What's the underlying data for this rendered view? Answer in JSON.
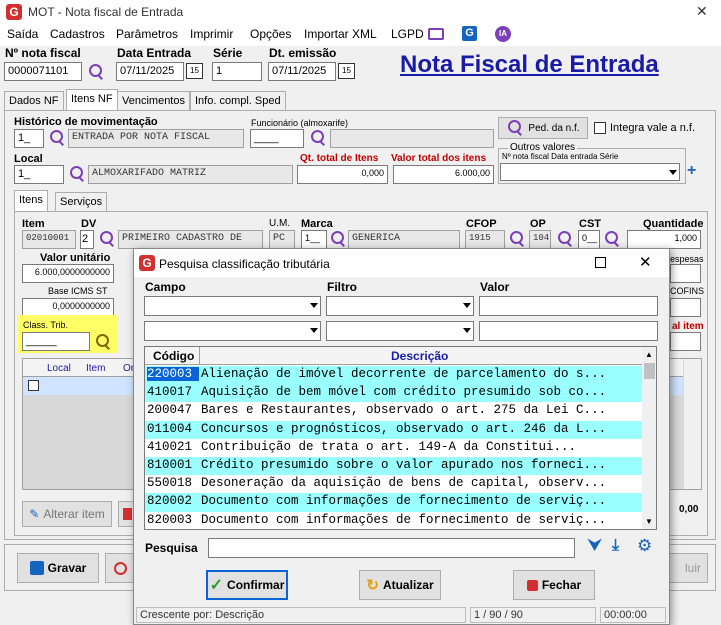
{
  "window": {
    "title": "MOT - Nota fiscal de Entrada",
    "close": "✕"
  },
  "menu": [
    "Saída",
    "Cadastros",
    "Parâmetros",
    "Imprimir",
    "Opções",
    "Importar XML",
    "LGPD"
  ],
  "menu_icons": [
    "monitor-icon",
    "g-brand-icon",
    "ia-icon"
  ],
  "ia_label": "IA",
  "header": {
    "nota_label": "Nº nota fiscal",
    "nota_value": "0000071101",
    "data_entrada_label": "Data Entrada",
    "data_entrada_value": "07/11/2025",
    "serie_label": "Série",
    "serie_value": "1",
    "dt_emissao_label": "Dt. emissão",
    "dt_emissao_value": "07/11/2025",
    "cal": "15",
    "big_title": "Nota Fiscal de Entrada"
  },
  "tabs": [
    "Dados NF",
    "Itens NF",
    "Vencimentos",
    "Info. compl. Sped"
  ],
  "itensnf": {
    "historico_label": "Histórico de movimentação",
    "historico_code": "1_",
    "historico_desc": "ENTRADA POR NOTA FISCAL",
    "funcionario_label": "Funcionário (almoxarife)",
    "funcionario_value": "____",
    "ped_button": "Ped. da n.f.",
    "integra_label": "Integra vale a n.f.",
    "local_label": "Local",
    "local_code": "1_",
    "local_desc": "ALMOXARIFADO MATRIZ",
    "qt_total_label": "Qt. total de Itens",
    "qt_total_value": "0,000",
    "valor_total_label": "Valor total dos itens",
    "valor_total_value": "6.000,00",
    "outros_label": "Outros valores",
    "outros_cols": "Nº nota fiscal   Data entrada   Série",
    "plus": "+"
  },
  "subtabs": [
    "Itens",
    "Serviços"
  ],
  "item": {
    "item_label": "Item",
    "item_value": "02010001",
    "dv_label": "DV",
    "dv_value": "2",
    "desc_value": "PRIMEIRO CADASTRO DE",
    "um_label": "U.M.",
    "um_value": "PC",
    "marca_label": "Marca",
    "marca_code": "1__",
    "marca_desc": "GENERICA",
    "cfop_label": "CFOP",
    "cfop_value": "1915",
    "op_label": "OP",
    "op_value": "104",
    "cst_label": "CST",
    "cst_value": "0__",
    "qtd_label": "Quantidade",
    "qtd_value": "1,000",
    "valor_unit_label": "Valor unitário",
    "valor_unit_value": "6.000,0000000000",
    "despesas_label": "espesas",
    "base_st_label": "Base ICMS ST",
    "base_st_value": "0,0000000000",
    "cofins_label": "COFINS",
    "class_trib_label": "Class. Trib.",
    "class_trib_value": "_____",
    "total_item_label": "al item"
  },
  "items_table": {
    "cols": [
      "Local",
      "Item",
      "Or"
    ]
  },
  "alterar_button": "Alterar item",
  "right_value": "0,00",
  "bottom": {
    "gravar": "Gravar",
    "excluir": "luir"
  },
  "dialog": {
    "title": "Pesquisa classificação tributária",
    "campo_label": "Campo",
    "filtro_label": "Filtro",
    "valor_label": "Valor",
    "col_codigo": "Código",
    "col_descricao": "Descrição",
    "rows": [
      {
        "codigo": "220003",
        "descricao": "Alienação de imóvel decorrente de parcelamento do s..."
      },
      {
        "codigo": "410017",
        "descricao": "Aquisição de bem móvel com crédito presumido sob co..."
      },
      {
        "codigo": "200047",
        "descricao": "Bares e Restaurantes, observado o art. 275 da Lei C..."
      },
      {
        "codigo": "011004",
        "descricao": "Concursos e prognósticos, observado o art. 246 da L..."
      },
      {
        "codigo": "410021",
        "descricao": "Contribuição de trata o art. 149-A da Constitui..."
      },
      {
        "codigo": "810001",
        "descricao": "Crédito presumido sobre o valor apurado nos forneci..."
      },
      {
        "codigo": "550018",
        "descricao": "Desoneração da aquisição de bens de capital, observ..."
      },
      {
        "codigo": "820002",
        "descricao": "Documento com informações de fornecimento de serviç..."
      },
      {
        "codigo": "820003",
        "descricao": "Documento com informações de fornecimento de serviç..."
      }
    ],
    "pesquisa_label": "Pesquisa",
    "confirmar": "Confirmar",
    "atualizar": "Atualizar",
    "fechar": "Fechar",
    "status_order": "Crescente por: Descrição",
    "status_count": "1 / 90 / 90",
    "status_time": "00:00:00"
  },
  "colors": {
    "title_blue": "#1a1aa8",
    "highlight": "#99ffff",
    "selection": "#0a64d8",
    "class_yellow": "#ffff66",
    "red_label": "#c00000"
  }
}
